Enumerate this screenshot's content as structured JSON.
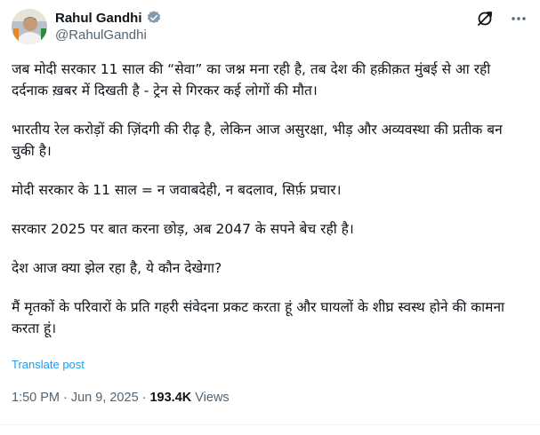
{
  "author": {
    "display_name": "Rahul Gandhi",
    "handle": "@RahulGandhi"
  },
  "icons": {
    "verified": "verified-badge-icon",
    "grok": "grok-icon",
    "more": "more-options-icon"
  },
  "tweet": {
    "paragraphs": [
      "जब मोदी सरकार 11 साल की “सेवा” का जश्न मना रही है, तब देश की हक़ीक़त मुंबई से आ रही दर्दनाक ख़बर में दिखती है - ट्रेन से गिरकर कई लोगों की मौत।",
      "भारतीय रेल करोड़ों की ज़िंदगी की रीढ़ है, लेकिन आज असुरक्षा, भीड़ और अव्यवस्था की प्रतीक बन चुकी है।",
      "मोदी सरकार के 11 साल = न जवाबदेही, न बदलाव, सिर्फ़ प्रचार।",
      "सरकार 2025 पर बात करना छोड़, अब 2047 के सपने बेच रही है।",
      "देश आज क्या झेल रहा है, ये कौन देखेगा?",
      "मैं मृतकों के परिवारों के प्रति गहरी संवेदना प्रकट करता हूं और घायलों के शीघ्र स्वस्थ होने की कामना करता हूं।"
    ],
    "translate_label": "Translate post",
    "time": "1:50 PM",
    "date": "Jun 9, 2025",
    "separator": "·",
    "views_count": "193.4K",
    "views_label": "Views"
  },
  "colors": {
    "link": "#1d9bf0",
    "secondary_text": "#536471",
    "primary_text": "#0f1419"
  }
}
